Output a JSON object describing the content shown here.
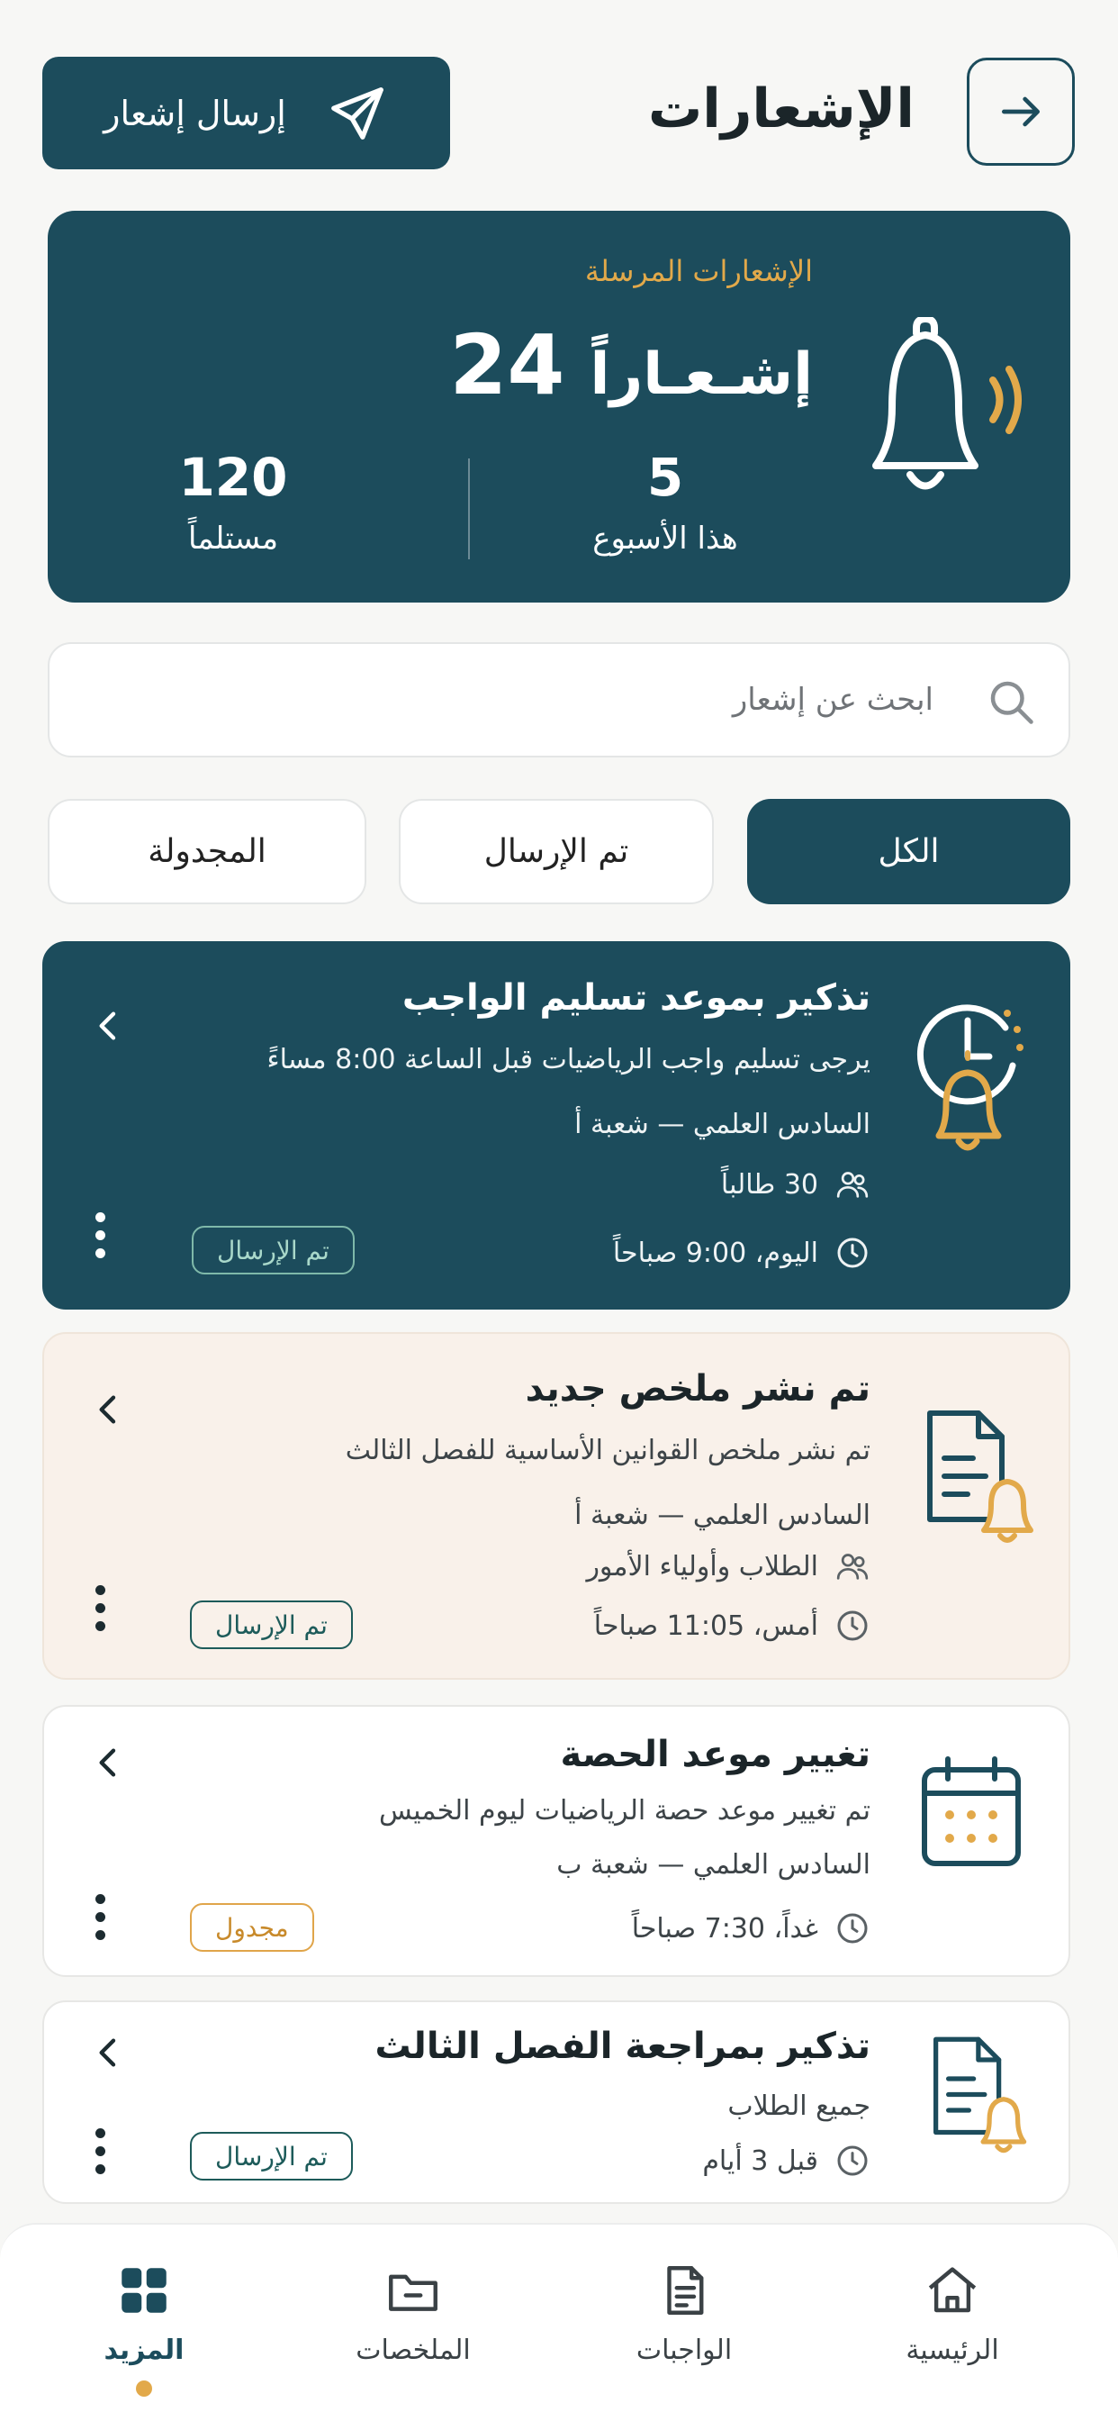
{
  "header": {
    "title": "الإشعارات",
    "send_label": "إرسال إشعار"
  },
  "stats": {
    "label": "الإشعارات المرسلة",
    "count": "24",
    "count_word": "إشـعـاراً",
    "week_value": "5",
    "week_label": "هذا الأسبوع",
    "recipients_value": "120",
    "recipients_label": "مستلماً"
  },
  "search": {
    "placeholder": "ابحث عن إشعار"
  },
  "tabs": [
    {
      "label": "الكل",
      "active": true
    },
    {
      "label": "تم الإرسال",
      "active": false
    },
    {
      "label": "المجدولة",
      "active": false
    }
  ],
  "notifications": [
    {
      "title": "تذكير بموعد تسليم الواجب",
      "body": "يرجى تسليم واجب الرياضيات قبل الساعة 8:00 مساءً",
      "class": "السادس العلمي — شعبة أ",
      "audience": "30 طالباً",
      "time": "اليوم، 9:00 صباحاً",
      "status": "تم الإرسال",
      "icon": "clock-bell-icon"
    },
    {
      "title": "تم نشر ملخص جديد",
      "body": "تم نشر ملخص القوانين الأساسية للفصل الثالث",
      "class": "السادس العلمي — شعبة أ",
      "audience": "الطلاب وأولياء الأمور",
      "time": "أمس، 11:05 صباحاً",
      "status": "تم الإرسال",
      "icon": "document-bell-icon"
    },
    {
      "title": "تغيير موعد الحصة",
      "body": "تم تغيير موعد حصة الرياضيات ليوم الخميس",
      "class": "السادس العلمي — شعبة ب",
      "time": "غداً، 7:30 صباحاً",
      "status": "مجدول",
      "icon": "calendar-icon"
    },
    {
      "title": "تذكير بمراجعة الفصل الثالث",
      "body": "جميع الطلاب",
      "time": "قبل 3 أيام",
      "status": "تم الإرسال",
      "icon": "document-bell-icon"
    }
  ],
  "nav": [
    {
      "label": "الرئيسية",
      "icon": "home-icon"
    },
    {
      "label": "الواجبات",
      "icon": "assignment-icon"
    },
    {
      "label": "الملخصات",
      "icon": "folder-icon"
    },
    {
      "label": "المزيد",
      "icon": "grid-icon",
      "active": true
    }
  ],
  "colors": {
    "primary": "#1c4c5c",
    "accent": "#e2a94a",
    "peach": "#f9f1ea"
  }
}
